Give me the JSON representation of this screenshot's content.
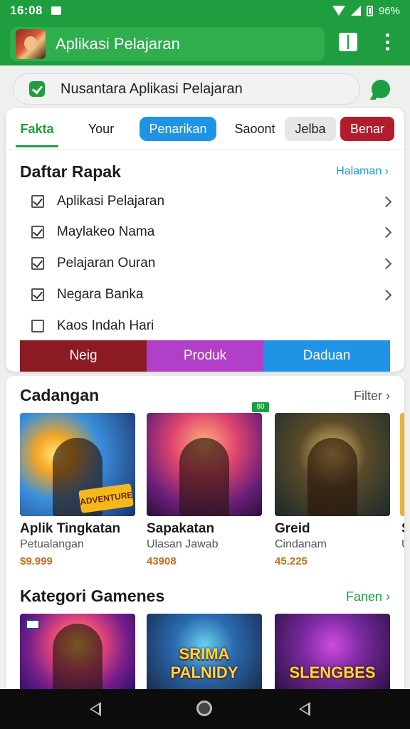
{
  "status_bar": {
    "time": "16:08",
    "battery": "96%"
  },
  "app_bar": {
    "title": "Aplikasi Pelajaran"
  },
  "search": {
    "text": "Nusantara Aplikasi Pelajaran"
  },
  "tabs": [
    {
      "label": "Fakta"
    },
    {
      "label": "Your"
    },
    {
      "label": "Penarikan"
    },
    {
      "label": "Saoont"
    },
    {
      "label": "Jelba"
    },
    {
      "label": "Benar"
    }
  ],
  "list_section": {
    "title": "Daftar Rapak",
    "link": "Halaman",
    "items": [
      {
        "label": "Aplikasi Pelajaran",
        "checked": true
      },
      {
        "label": "Maylakeo Nama",
        "checked": true
      },
      {
        "label": "Pelajaran Ouran",
        "checked": true
      },
      {
        "label": "Negara Banka",
        "checked": true
      },
      {
        "label": "Kaos Indah Hari",
        "checked": false
      }
    ]
  },
  "segments": [
    {
      "label": "Neig"
    },
    {
      "label": "Produk"
    },
    {
      "label": "Daduan"
    }
  ],
  "games_section": {
    "title": "Cadangan",
    "link": "Filter",
    "badge": "80",
    "items": [
      {
        "name": "Aplik Tingkatan",
        "subtitle": "Petualangan",
        "price": "$9.999",
        "tag": "ADVENTURE"
      },
      {
        "name": "Sapakatan",
        "subtitle": "Ulasan Jawab",
        "price": "43908"
      },
      {
        "name": "Greid",
        "subtitle": "Cindanam",
        "price": "45.225"
      },
      {
        "name": "S",
        "subtitle": "U",
        "price": ""
      }
    ]
  },
  "category_section": {
    "title": "Kategori Gamenes",
    "link": "Fanen",
    "items": [
      {
        "label": ""
      },
      {
        "label": "SRIMA PALNIDY"
      },
      {
        "label": "SLENGBES"
      }
    ]
  },
  "colors": {
    "brand_green": "#1e9e3e",
    "accent_blue": "#1f93e6",
    "accent_red": "#b01e2e",
    "accent_purple": "#b23fc8",
    "price_orange": "#c0701c"
  }
}
